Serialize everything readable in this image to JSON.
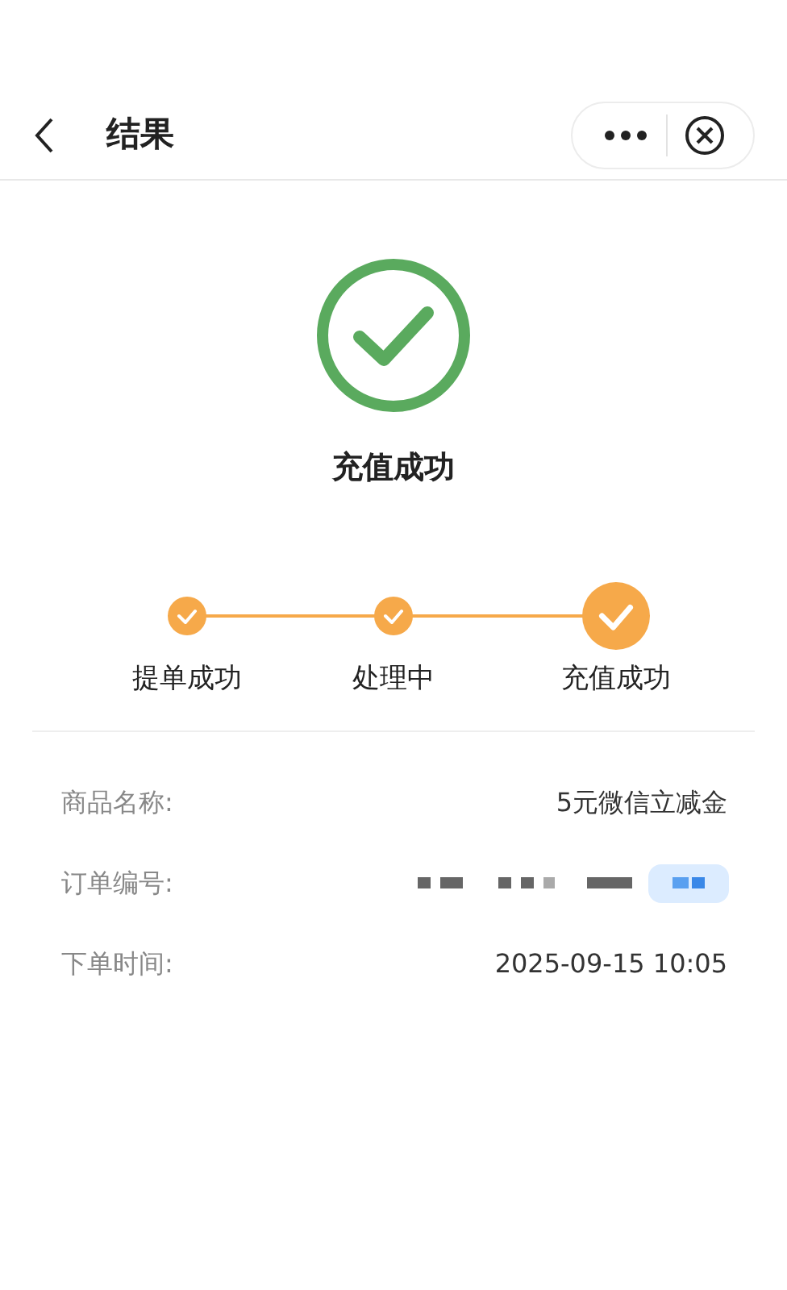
{
  "header": {
    "title": "结果"
  },
  "result": {
    "status": "充值成功"
  },
  "steps": [
    {
      "label": "提单成功",
      "done": true,
      "selected": false
    },
    {
      "label": "处理中",
      "done": true,
      "selected": false
    },
    {
      "label": "充值成功",
      "done": true,
      "selected": true
    }
  ],
  "details": [
    {
      "label": "商品名称:",
      "value": "5元微信立减金",
      "redacted": false
    },
    {
      "label": "订单编号:",
      "redacted": true
    },
    {
      "label": "下单时间:",
      "value": "2025-09-15 10:05",
      "redacted": false
    }
  ]
}
